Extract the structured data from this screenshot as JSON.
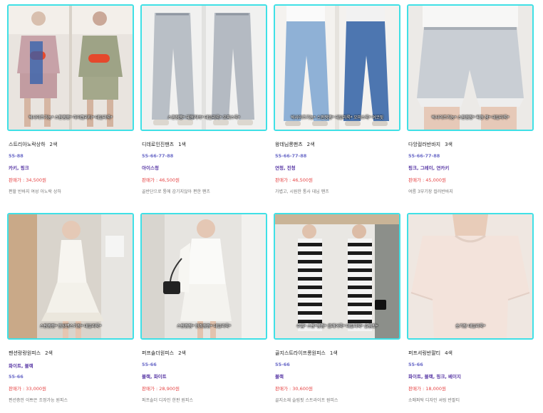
{
  "products": [
    {
      "badge": "빅사이즈가능* 스판짱짱* 하이퀄리티* 데일리룩*",
      "name": "스트리아노락상하",
      "count": "2색",
      "sizes": "55-88",
      "colors": "카키, 핑크",
      "price": "판매가 : 34,500원",
      "desc": "편할 반바지 여성 아노락 상하"
    },
    {
      "badge": "스판짱짱* 체형커버* 데일리룩* 오피스룩*",
      "name": "디데로인진팬츠",
      "count": "1색",
      "sizes": "55-66-77-88",
      "colors": "아이스청",
      "price": "판매가 : 46,500원",
      "desc": "골반단으로 통에 감기지않아 편한 팬츠"
    },
    {
      "badge": "빅사이즈가능* 스판짱짱* 데일리룩* 오피스룩* 여코핏",
      "name": "왕데님롱팬츠",
      "count": "2색",
      "sizes": "55-66-77-88",
      "colors": "연청, 진청",
      "price": "판매가 : 46,500원",
      "desc": "가볍고, 시원한 통사 데님 팬츠"
    },
    {
      "badge": "빅사이즈가능* 스판짱짱* 퀵정-팡* 데일리룩*",
      "name": "다앙컬러반바지",
      "count": "3색",
      "sizes": "55-66-77-88",
      "colors": "핑크, 그레이, 연카키",
      "price": "판매가 : 45,000원",
      "desc": "여름 3부기장 컬러반바지"
    },
    {
      "badge": "스판짱짱* 안방면스기장* 데일리룩*",
      "name": "팬션랑랑원피스",
      "count": "2색",
      "sizes": "",
      "colors": "화이트, 블랙",
      "price": "판매가 : 33,000원",
      "desc": "편션층안 이쁘은 조정가능 원피스"
    },
    {
      "badge": "스판짱짱* 인정짱짱* 데일리룩*",
      "name": "퍼프솔더원피스",
      "count": "2색",
      "sizes": "55-66",
      "colors": "블랙, 화이트",
      "price": "판매가 : 28,900원",
      "desc": "퍼프솔더 디자인 한판 원피스"
    },
    {
      "badge": "수입* 스판*짱짱* 클래어룩* 데일리룩* 슬림핏*",
      "name": "골지스트라이프롱원피스",
      "count": "1색",
      "sizes": "55-66",
      "colors": "블랙",
      "price": "판매가 : 30,600원",
      "desc": "골지소재 슬림핏 스트라이프 원피스"
    },
    {
      "badge": "숏기장 데일리룩*",
      "name": "퍼프셔링반팔티",
      "count": "4색",
      "sizes": "55-66",
      "colors": "화이트, 블랙, 핑크, 베이지",
      "price": "판매가 : 18,000원",
      "desc": "소매퍼탁 디자인 셔링 반팔티"
    }
  ]
}
